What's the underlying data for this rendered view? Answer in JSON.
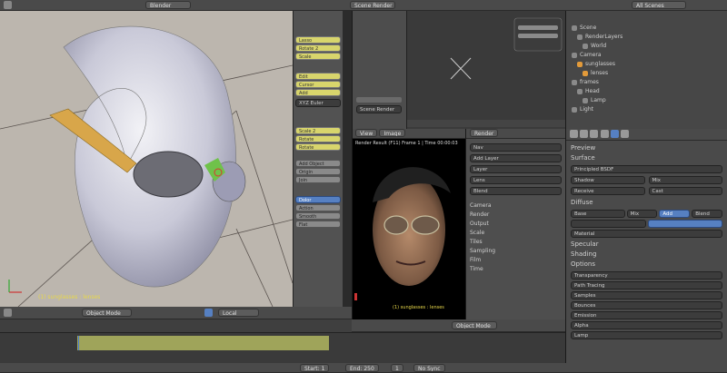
{
  "top_header": {
    "left_menu": "Blender",
    "center_menu": "Scene Render",
    "right_menu": "All Scenes"
  },
  "viewport": {
    "status": "(1) sunglasses : lenses",
    "mode": "Object Mode",
    "pivot": "Local"
  },
  "tool_shelf": {
    "yellow_buttons_1": [
      "Lasso",
      "Rotate 2",
      "Scale"
    ],
    "yellow_buttons_2": [
      "Edit",
      "Cursor",
      "Add"
    ],
    "dropdown": "XYZ Euler",
    "yellow_buttons_3": [
      "Scale 2",
      "Rotate",
      "Rotate"
    ],
    "gray_buttons": [
      "Add Object",
      "Origin",
      "Join"
    ],
    "blue_button": "Dolor",
    "toggle": "Action",
    "extra_buttons": [
      "Smooth",
      "Flat"
    ]
  },
  "node_editor": {
    "header_label": "Scene Render"
  },
  "render_panel": {
    "header": [
      "View",
      "Image"
    ],
    "title": "Render Result (F11) Frame 1 | Time 00:00:03",
    "footer_label": "(1) sunglasses : lenses",
    "mode_select": "Object Mode"
  },
  "props_mid": {
    "tab": "Render",
    "buttons": [
      "Nav",
      "Add Layer",
      "Layer",
      "Lens",
      "Blend"
    ],
    "fields": [
      "Camera",
      "Render",
      "Output",
      "Scale",
      "Tiles",
      "Sampling",
      "Film",
      "Time"
    ]
  },
  "outliner": {
    "rows": [
      "Scene",
      "RenderLayers",
      "World",
      "Camera",
      "sunglasses",
      "lenses",
      "frames",
      "Head",
      "Lamp",
      "Light"
    ]
  },
  "properties": {
    "labels": [
      "Preview",
      "Surface",
      "Diffuse",
      "Specular",
      "Shading",
      "Options"
    ],
    "checkboxes": [
      "Shadow",
      "Mix",
      "Receive",
      "Cast"
    ],
    "select": "Principled BSDF",
    "tabs": [
      "Mix",
      "Add",
      "Blend"
    ],
    "value_field": "Base",
    "dropdown": "Material",
    "bottom_rows": [
      "Transparency",
      "Path Tracing",
      "Samples",
      "Bounces",
      "Emission",
      "Alpha",
      "Lamp"
    ]
  },
  "timeline": {
    "start": "Start: 1",
    "end": "End: 250",
    "frame": "1",
    "sync": "No Sync"
  },
  "colors": {
    "accent": "#5680c2",
    "viewport_bg": "#bcb6ae",
    "timeline_range": "#9fa45a"
  }
}
